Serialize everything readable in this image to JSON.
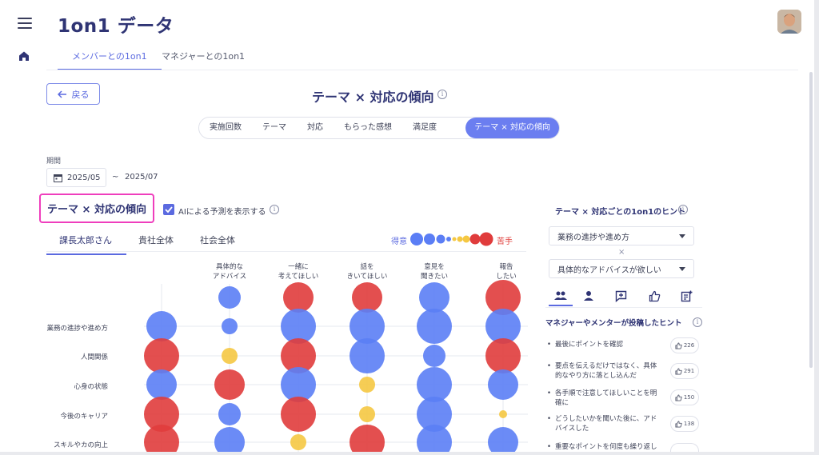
{
  "app": {
    "title": "1on1 データ",
    "tabs": [
      {
        "label": "メンバーとの1on1",
        "active": true
      },
      {
        "label": "マネジャーとの1on1",
        "active": false
      }
    ]
  },
  "header": {
    "back_label": "戻る",
    "page_title": "テーマ × 対応の傾向"
  },
  "segments": [
    "実施回数",
    "テーマ",
    "対応",
    "もらった感想",
    "満足度",
    "テーマ × 対応の傾向"
  ],
  "period": {
    "label": "期間",
    "start": "2025/05",
    "separator": "~",
    "end": "2025/07"
  },
  "section": {
    "title": "テーマ × 対応の傾向",
    "ai_toggle_label": "AIによる予測を表示する",
    "ai_toggle_checked": true
  },
  "sub_tabs": [
    {
      "label": "課長太郎さん",
      "active": true
    },
    {
      "label": "貴社全体",
      "active": false
    },
    {
      "label": "社会全体",
      "active": false
    }
  ],
  "legend": {
    "good_label": "得意",
    "bad_label": "苦手",
    "colors": {
      "good": "#5b7ef5",
      "neutral": "#f5c842",
      "bad": "#e03c3c"
    }
  },
  "chart_data": {
    "type": "bubble-matrix",
    "columns": [
      "",
      "具体的な\nアドバイス",
      "一緒に\n考えてほしい",
      "話を\nきいてほしい",
      "意見を\n聞きたい",
      "報告\nしたい"
    ],
    "rows": [
      "",
      "業務の進捗や進め方",
      "人間関係",
      "心身の状態",
      "今後のキャリア",
      "スキルやカの向上"
    ],
    "cells": [
      [
        {
          "c": "blue",
          "s": 0
        },
        {
          "c": "blue",
          "s": 2
        },
        {
          "c": "red",
          "s": 3
        },
        {
          "c": "red",
          "s": 3
        },
        {
          "c": "blue",
          "s": 3
        },
        {
          "c": "red",
          "s": 4
        }
      ],
      [
        {
          "c": "blue",
          "s": 3
        },
        {
          "c": "blue",
          "s": 1
        },
        {
          "c": "blue",
          "s": 4
        },
        {
          "c": "blue",
          "s": 4
        },
        {
          "c": "blue",
          "s": 4
        },
        {
          "c": "blue",
          "s": 4
        }
      ],
      [
        {
          "c": "red",
          "s": 4
        },
        {
          "c": "yellow",
          "s": 1
        },
        {
          "c": "red",
          "s": 4
        },
        {
          "c": "blue",
          "s": 4
        },
        {
          "c": "blue",
          "s": 2
        },
        {
          "c": "red",
          "s": 4
        }
      ],
      [
        {
          "c": "blue",
          "s": 3
        },
        {
          "c": "red",
          "s": 3
        },
        {
          "c": "blue",
          "s": 4
        },
        {
          "c": "yellow",
          "s": 1
        },
        {
          "c": "blue",
          "s": 4
        },
        {
          "c": "blue",
          "s": 3
        }
      ],
      [
        {
          "c": "red",
          "s": 4
        },
        {
          "c": "blue",
          "s": 2
        },
        {
          "c": "red",
          "s": 4
        },
        {
          "c": "yellow",
          "s": 1
        },
        {
          "c": "blue",
          "s": 4
        },
        {
          "c": "yellow",
          "s": 0
        }
      ],
      [
        {
          "c": "red",
          "s": 4
        },
        {
          "c": "blue",
          "s": 3
        },
        {
          "c": "yellow",
          "s": 1
        },
        {
          "c": "red",
          "s": 4
        },
        {
          "c": "blue",
          "s": 4
        },
        {
          "c": "blue",
          "s": 3
        }
      ]
    ]
  },
  "hints": {
    "title": "テーマ × 対応ごとの1on1のヒント",
    "theme_select": "業務の進捗や進め方",
    "times": "×",
    "response_select": "具体的なアドバイスが欲しい",
    "icon_tabs": [
      "people-icon",
      "person-icon",
      "add-comment-icon",
      "thumbs-up-icon",
      "post-add-icon"
    ],
    "heading": "マネジャーやメンターが投稿したヒント",
    "items": [
      {
        "text": "最後にポイントを確認",
        "likes": "226"
      },
      {
        "text": "要点を伝えるだけではなく、具体的なやり方に落とし込んだ",
        "likes": "291"
      },
      {
        "text": "各手順で注意してほしいことを明確に",
        "likes": "150"
      },
      {
        "text": "どうしたいかを聞いた後に、アドバイスした",
        "likes": "138"
      },
      {
        "text": "重要なポイントを何度も繰り返し伝",
        "likes": ""
      }
    ]
  }
}
